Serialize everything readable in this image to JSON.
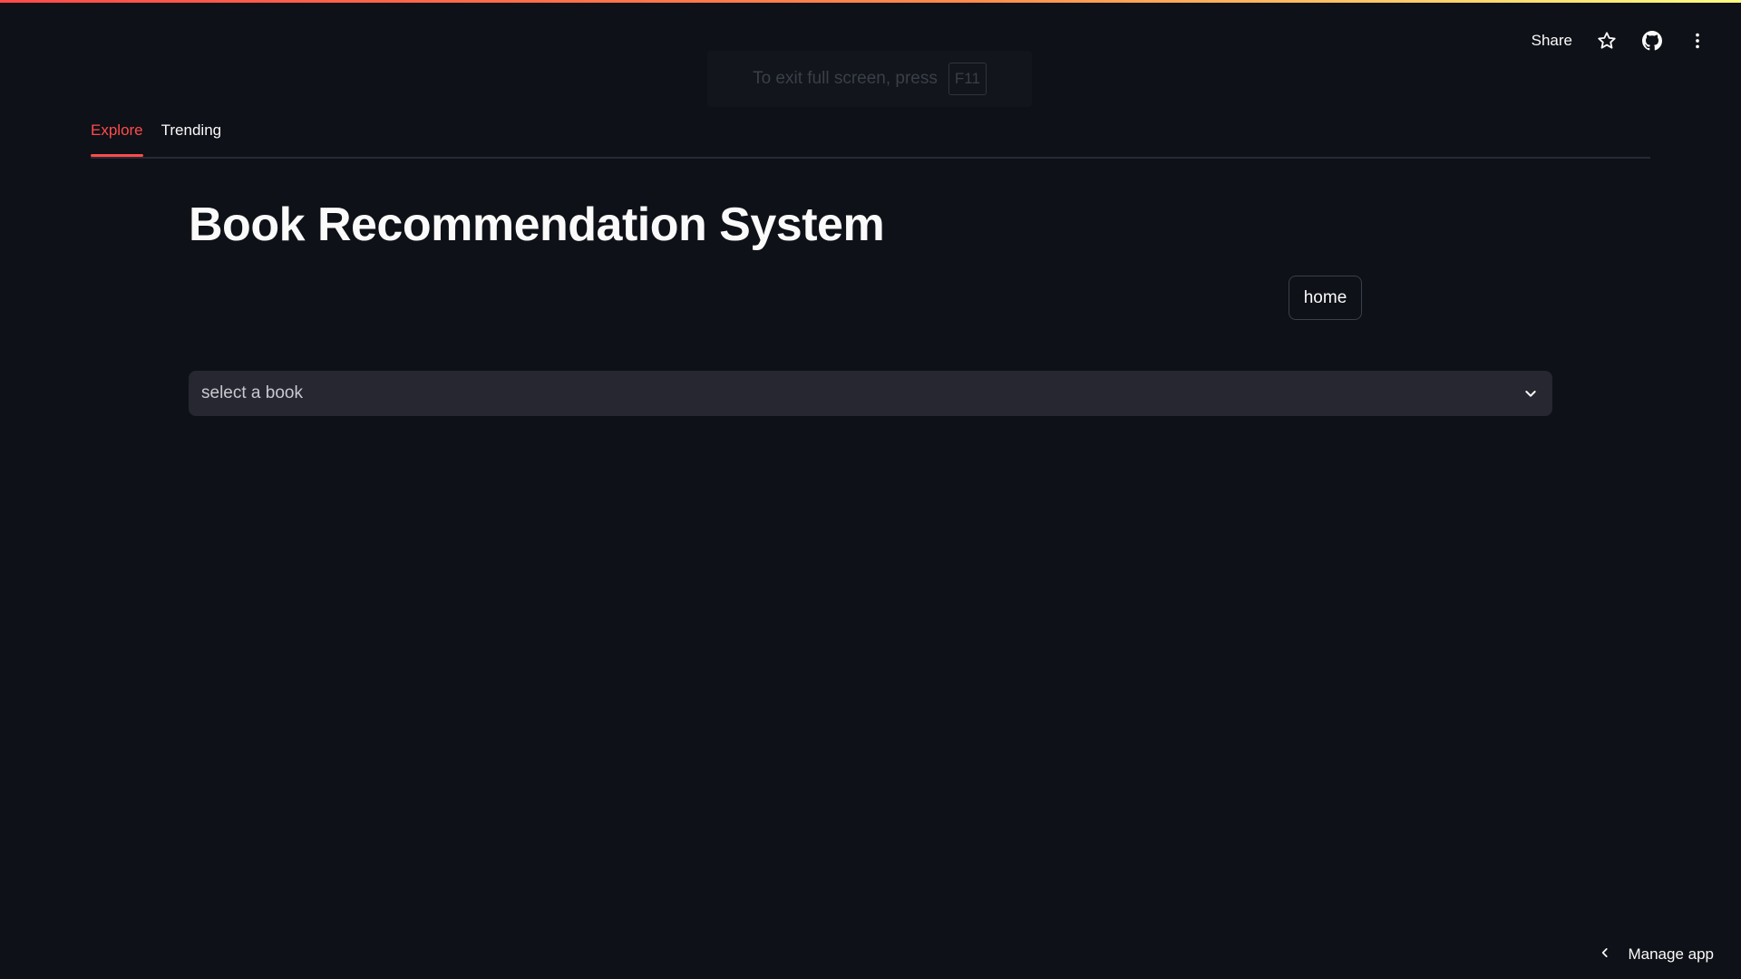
{
  "header": {
    "share_label": "Share",
    "icons": [
      "star-icon",
      "github-icon",
      "more-vertical-icon"
    ]
  },
  "fullscreen_notice": {
    "text": "To exit full screen, press",
    "key": "F11"
  },
  "tabs": [
    {
      "label": "Explore",
      "active": true
    },
    {
      "label": "Trending",
      "active": false
    }
  ],
  "main": {
    "title": "Book Recommendation System",
    "home_button": "home",
    "book_select": {
      "placeholder": "select a book"
    }
  },
  "footer": {
    "manage_app_label": "Manage app"
  },
  "colors": {
    "background": "#0e1117",
    "accent": "#ff4b4b",
    "input_bg": "#262730",
    "text": "#fafafa"
  }
}
